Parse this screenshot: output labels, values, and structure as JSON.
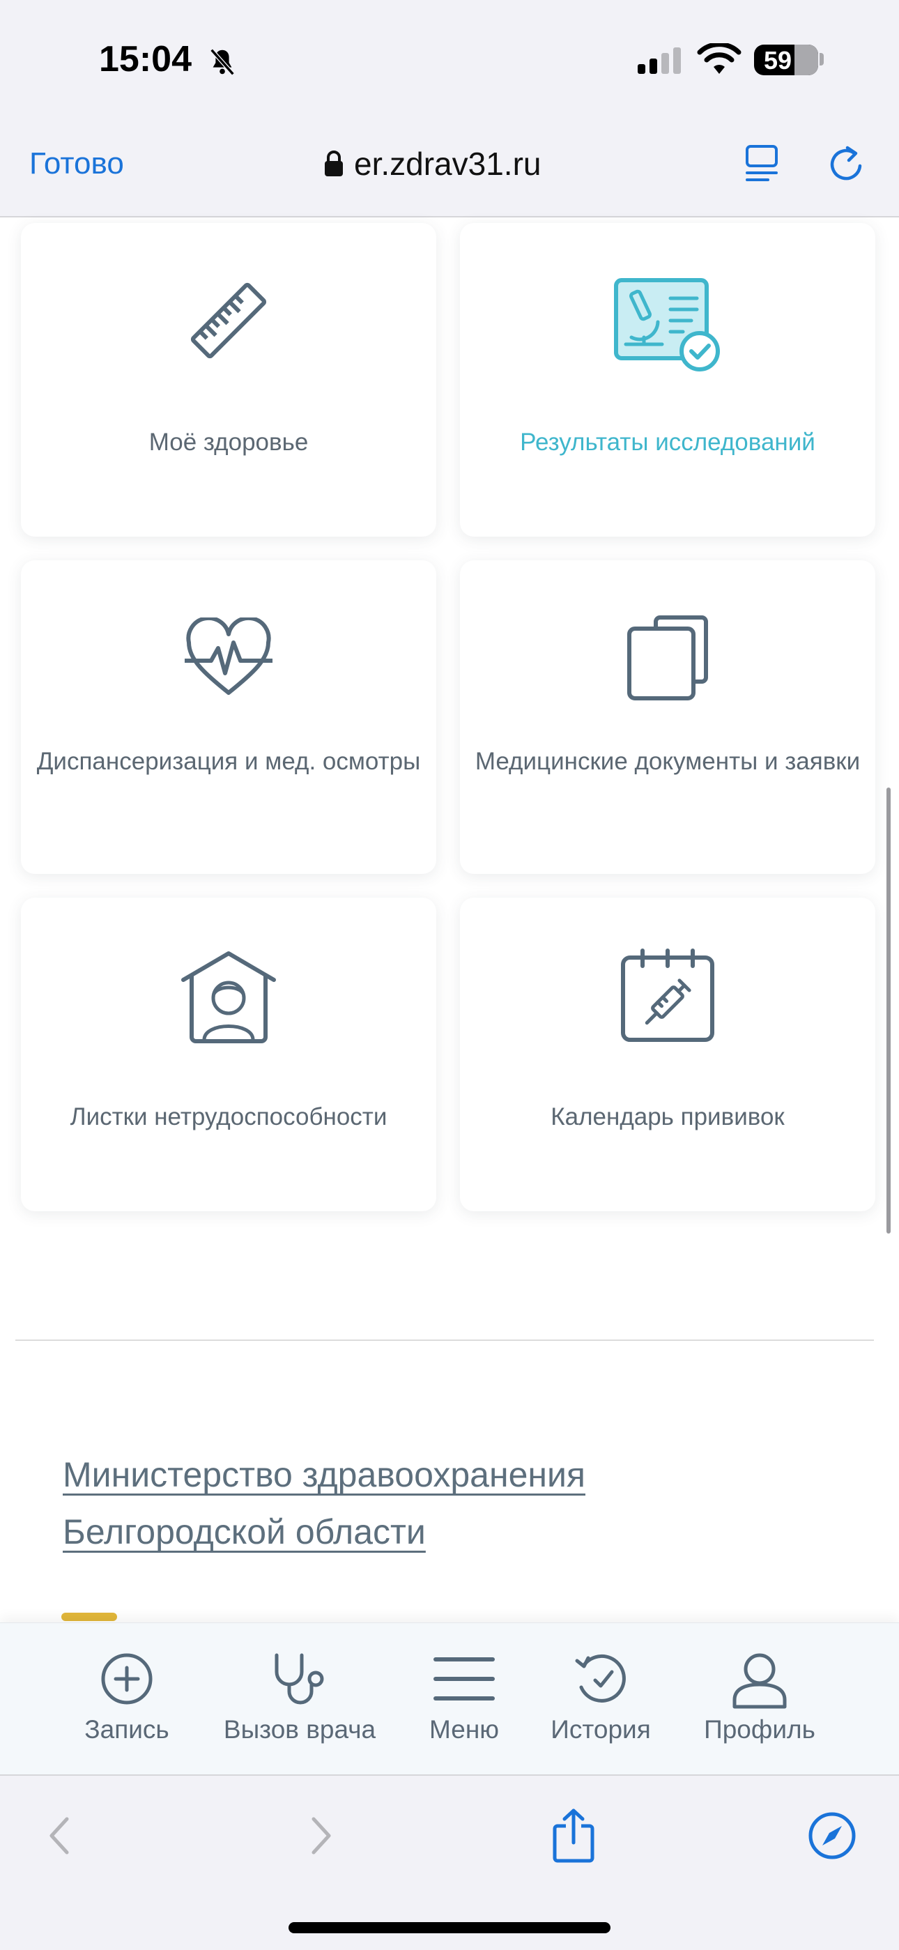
{
  "status_bar": {
    "time": "15:04",
    "battery": "59"
  },
  "browser": {
    "done_label": "Готово",
    "url": "er.zdrav31.ru"
  },
  "tiles": [
    {
      "label": "Моё здоровье",
      "icon": "ruler-icon"
    },
    {
      "label": "Результаты исследований",
      "icon": "microscope-report-icon",
      "highlighted": true
    },
    {
      "label": "Диспансеризация и мед. осмотры",
      "icon": "heart-pulse-icon"
    },
    {
      "label": "Медицинские документы и заявки",
      "icon": "documents-icon"
    },
    {
      "label": "Листки нетрудоспособности",
      "icon": "house-person-icon"
    },
    {
      "label": "Календарь прививок",
      "icon": "calendar-syringe-icon"
    }
  ],
  "footer": {
    "ministry_line1": "Министерство здравоохранения",
    "ministry_line2": "Белгородской области"
  },
  "bottom_nav": [
    {
      "label": "Запись",
      "icon": "plus-circle-icon"
    },
    {
      "label": "Вызов врача",
      "icon": "stethoscope-icon"
    },
    {
      "label": "Меню",
      "icon": "menu-icon"
    },
    {
      "label": "История",
      "icon": "history-icon"
    },
    {
      "label": "Профиль",
      "icon": "profile-icon"
    }
  ],
  "colors": {
    "accent": "#3fb6cc",
    "icon": "#55697a",
    "ios_blue": "#1a73d9"
  }
}
